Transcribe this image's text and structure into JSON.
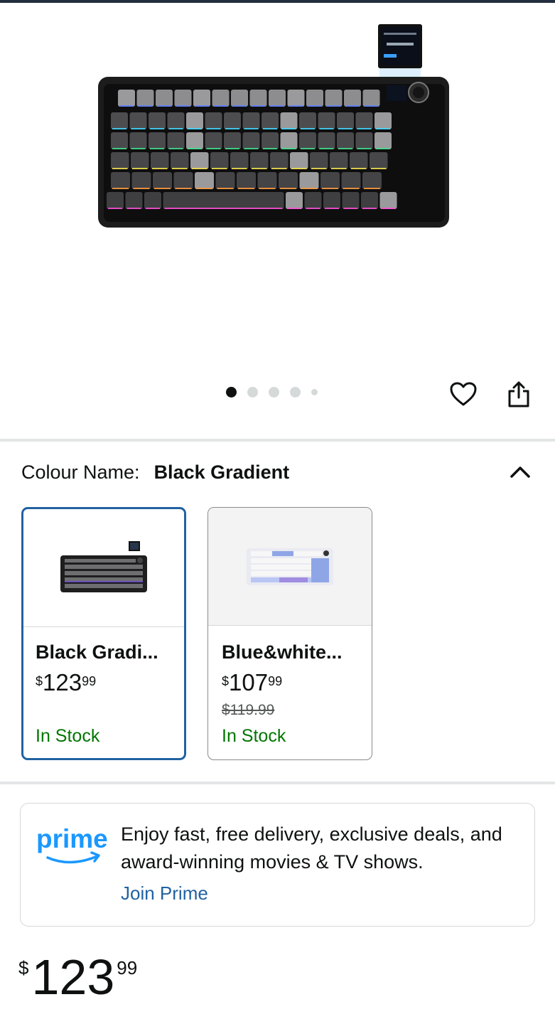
{
  "gallery": {
    "dot_count": 5,
    "active_index": 0,
    "wishlist_icon": "heart-outline-icon",
    "share_icon": "share-icon"
  },
  "colour": {
    "label": "Colour Name:",
    "selected_value": "Black Gradient",
    "collapse_icon": "chevron-up-icon"
  },
  "swatches": [
    {
      "name": "Black Gradi...",
      "price_currency": "$",
      "price_whole": "123",
      "price_fraction": "99",
      "was_price": "",
      "stock": "In Stock",
      "selected": true
    },
    {
      "name": "Blue&white...",
      "price_currency": "$",
      "price_whole": "107",
      "price_fraction": "99",
      "was_price": "$119.99",
      "stock": "In Stock",
      "selected": false
    }
  ],
  "prime": {
    "logo_text": "prime",
    "pitch": "Enjoy fast, free delivery, exclusive deals, and award-winning movies & TV shows.",
    "link_label": "Join Prime"
  },
  "price": {
    "currency": "$",
    "whole": "123",
    "fraction": "99"
  },
  "colors": {
    "selected_border": "#2162a1",
    "in_stock": "#007600",
    "link": "#2162a1",
    "prime_blue": "#1a98ff",
    "divider": "#e3e6e6"
  }
}
